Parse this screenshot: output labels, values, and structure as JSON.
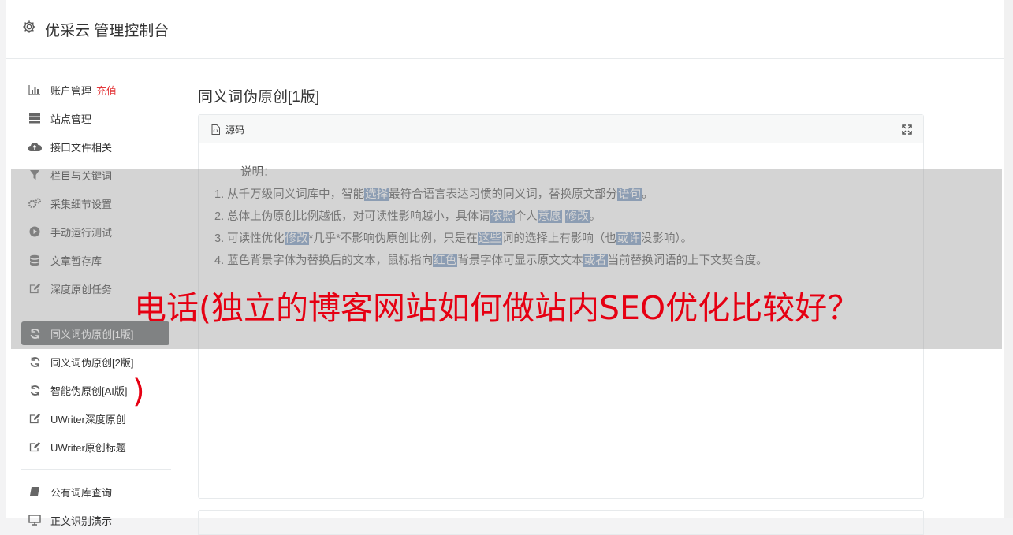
{
  "header": {
    "title": "优采云 管理控制台"
  },
  "sidebar": {
    "items": [
      {
        "label": "账户管理",
        "badge": "充值",
        "icon": "bar-chart-icon"
      },
      {
        "label": "站点管理",
        "icon": "server-icon"
      },
      {
        "label": "接口文件相关",
        "icon": "cloud-upload-icon"
      },
      {
        "label": "栏目与关键词",
        "icon": "filter-icon"
      },
      {
        "label": "采集细节设置",
        "icon": "gears-icon"
      },
      {
        "label": "手动运行测试",
        "icon": "play-circle-icon"
      },
      {
        "label": "文章暂存库",
        "icon": "database-icon"
      },
      {
        "label": "深度原创任务",
        "icon": "edit-icon"
      },
      {
        "label": "同义词伪原创[1版]",
        "icon": "refresh-icon",
        "active": true
      },
      {
        "label": "同义词伪原创[2版]",
        "icon": "refresh-icon"
      },
      {
        "label": "智能伪原创[AI版]",
        "icon": "refresh-icon"
      },
      {
        "label": "UWriter深度原创",
        "icon": "edit-icon"
      },
      {
        "label": "UWriter原创标题",
        "icon": "edit-icon"
      },
      {
        "label": "公有词库查询",
        "icon": "book-icon"
      },
      {
        "label": "正文识别演示",
        "icon": "desktop-icon"
      }
    ]
  },
  "main": {
    "page_title": "同义词伪原创[1版]",
    "box_label": "源码",
    "notes_heading": "说明：",
    "notes": [
      [
        "1. 从千万级同义词库中，智能",
        {
          "hl": "选择"
        },
        "最符合语言表达习惯的同义词，替换原文部分",
        {
          "hl": "语句"
        },
        "。"
      ],
      [
        "2. 总体上伪原创比例越低，对可读性影响越小，具体请",
        {
          "hl": "依照"
        },
        "个人",
        {
          "hl": "意愿"
        },
        " ",
        {
          "hl": "修改"
        },
        "。"
      ],
      [
        "3. 可读性优化",
        {
          "hl": "修改"
        },
        "*几乎*不影响伪原创比例，只是在",
        {
          "hl": "这些"
        },
        "词的选择上有影响（也",
        {
          "hl": "或许"
        },
        "没影响）。"
      ],
      [
        "4. 蓝色背景字体为替换后的文本，鼠标指向",
        {
          "hl": "红色"
        },
        "背景字体可显示原文文本",
        {
          "hl": "或者"
        },
        "当前替换词语的上下文契合度。"
      ]
    ]
  },
  "overlay": {
    "text": "电话(独立的博客网站如何做站内SEO优化比较好？",
    "paren": ")"
  },
  "colors": {
    "active_bg": "#676a6c",
    "highlight": "#7d9bc3",
    "overlay_text": "#e60012",
    "recharge": "#e4393c"
  }
}
